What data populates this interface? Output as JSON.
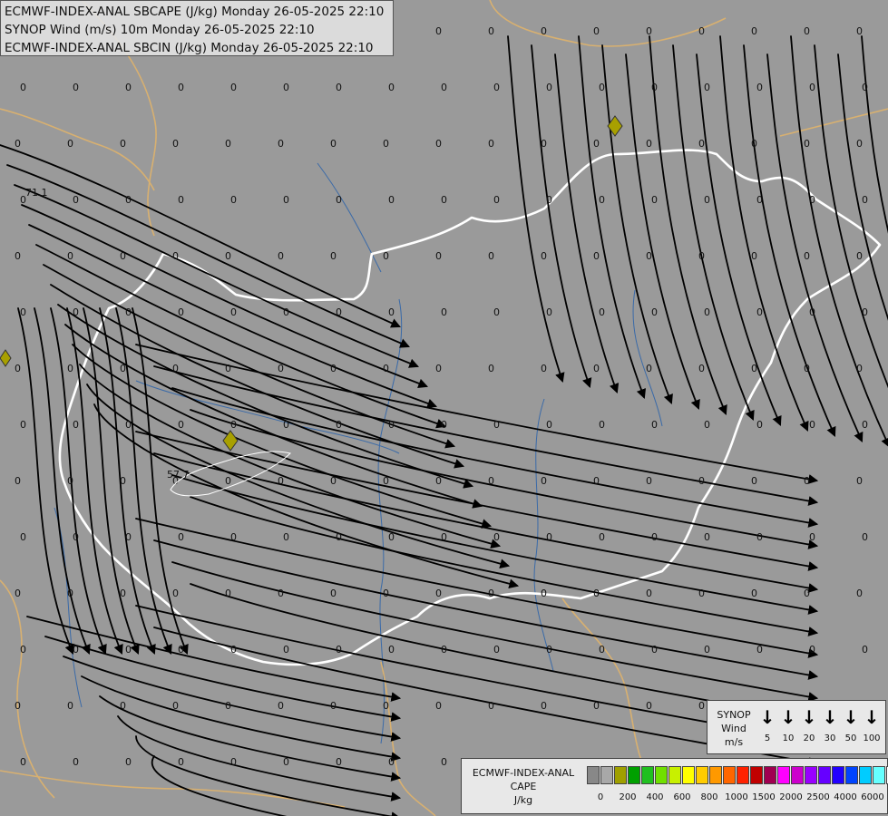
{
  "title": {
    "line1": "ECMWF-INDEX-ANAL SBCAPE (J/kg) Monday 26-05-2025 22:10",
    "line2": "SYNOP Wind (m/s) 10m Monday 26-05-2025 22:10",
    "line3": "ECMWF-INDEX-ANAL SBCIN (J/kg) Monday 26-05-2025 22:10"
  },
  "map_labels": [
    {
      "text": "71.1"
    },
    {
      "text": "57.7"
    }
  ],
  "grid_value": "0",
  "wind_legend": {
    "label_lines": [
      "SYNOP",
      "Wind",
      "m/s"
    ],
    "speeds": [
      "5",
      "10",
      "20",
      "30",
      "50",
      "100"
    ]
  },
  "cape_legend": {
    "title_lines": [
      "ECMWF-INDEX-ANAL",
      "CAPE",
      "J/kg"
    ],
    "colors": [
      "#888888",
      "#a8a8a8",
      "#a0a000",
      "#00a000",
      "#20c020",
      "#70e000",
      "#c8f000",
      "#ffff00",
      "#ffcc00",
      "#ff9900",
      "#ff6600",
      "#ff2200",
      "#c00000",
      "#a00050",
      "#ff00ff",
      "#cc00cc",
      "#9900ff",
      "#6600ff",
      "#2200ff",
      "#0044ff",
      "#00ccff",
      "#66ffff",
      "#ffffff"
    ],
    "ticks": [
      "0",
      "200",
      "400",
      "600",
      "800",
      "1000",
      "1500",
      "2000",
      "2500",
      "4000",
      "6000"
    ]
  },
  "colors": {
    "background": "#9a9a9a",
    "border_line": "#ffffff",
    "streamline": "#000000",
    "admin_border": "#d8b070",
    "river": "#3a6aa8"
  }
}
